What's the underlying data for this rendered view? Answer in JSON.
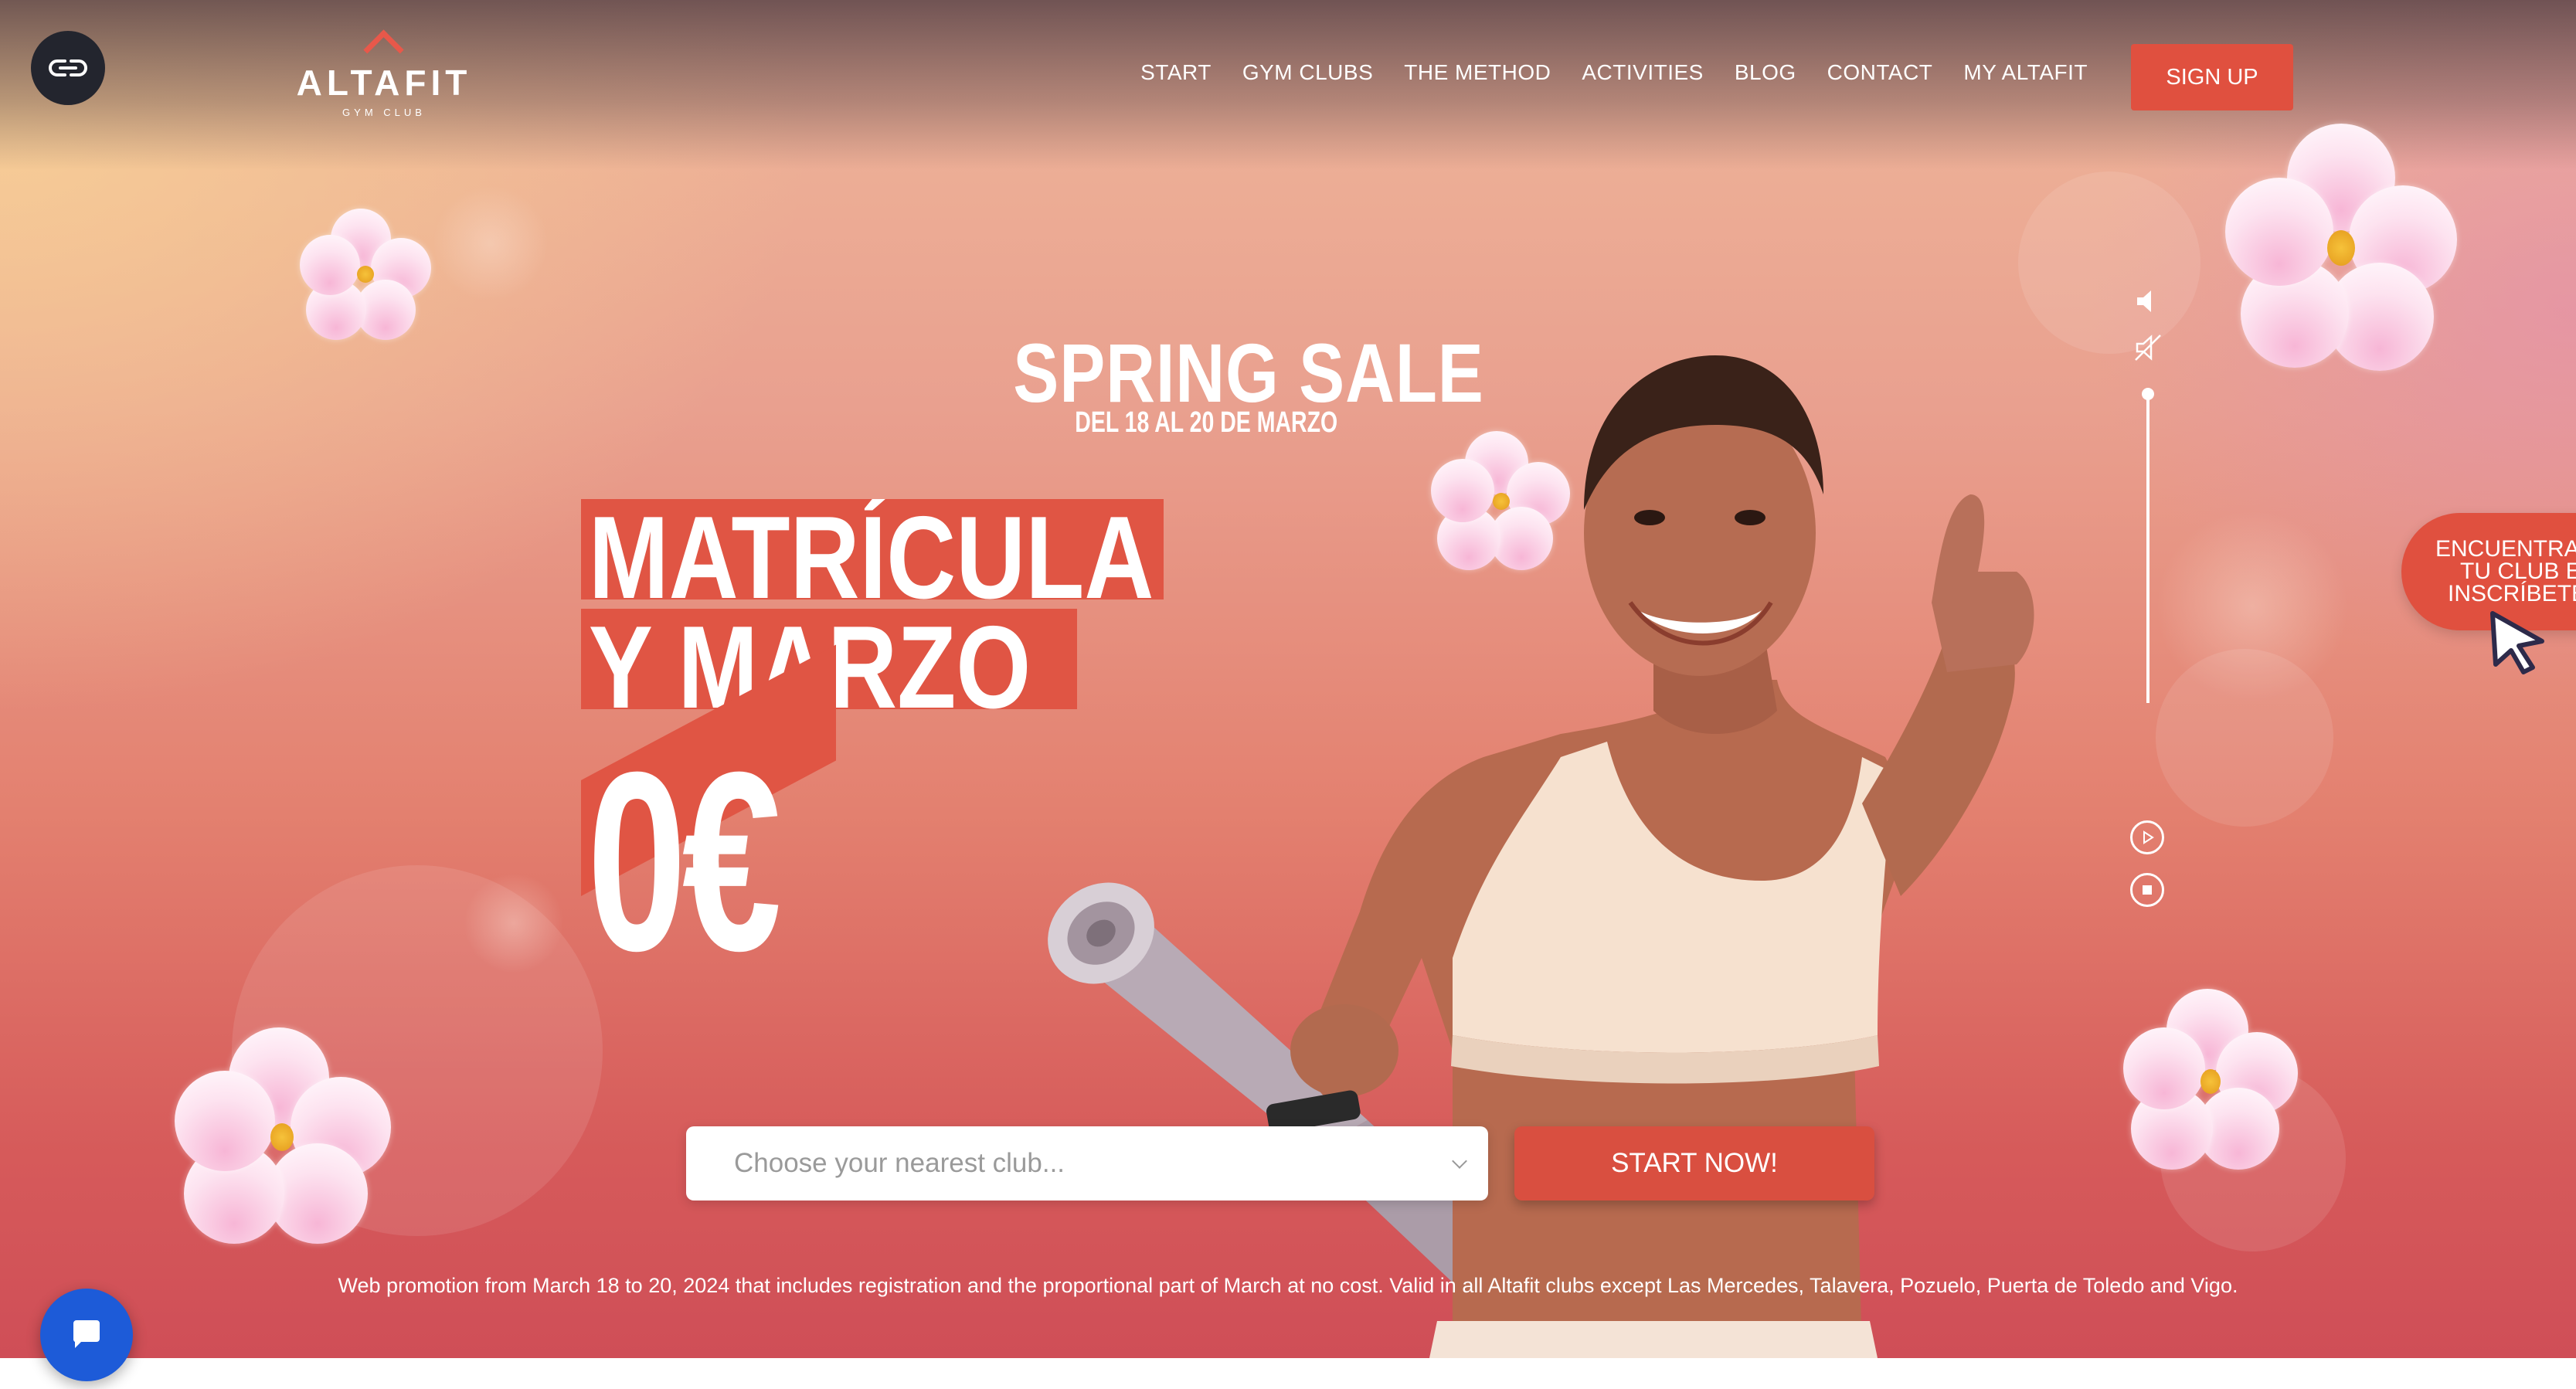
{
  "brand": {
    "name": "ALTAFIT",
    "tagline": "GYM CLUB"
  },
  "nav": {
    "items": [
      "START",
      "GYM CLUBS",
      "THE METHOD",
      "ACTIVITIES",
      "BLOG",
      "CONTACT",
      "MY ALTAFIT"
    ],
    "signup_label": "SIGN UP"
  },
  "hero": {
    "title": "SPRING SALE",
    "dates": "DEL 18 AL 20 DE MARZO",
    "line1": "MATRÍCULA",
    "line2": "Y MARZO",
    "price": "0€"
  },
  "side_tab": {
    "lines": [
      "ENCUENTRA",
      "TU CLUB E",
      "INSCRÍBETE"
    ]
  },
  "form": {
    "select_placeholder": "Choose your nearest club...",
    "submit_label": "START NOW!"
  },
  "disclaimer": "Web promotion from March 18 to 20, 2024 that includes registration and the proportional part of March at no cost. Valid in all Altafit clubs except Las Mercedes, Talavera, Pozuelo, Puerta de Toledo and Vigo.",
  "colors": {
    "accent": "#e0503f",
    "chat": "#1d5bd8",
    "dark": "#23252e"
  },
  "icons": [
    "accessibility-icon",
    "volume-icon",
    "mute-icon",
    "play-icon",
    "stop-icon",
    "cursor-arrow-icon",
    "chat-icon"
  ]
}
